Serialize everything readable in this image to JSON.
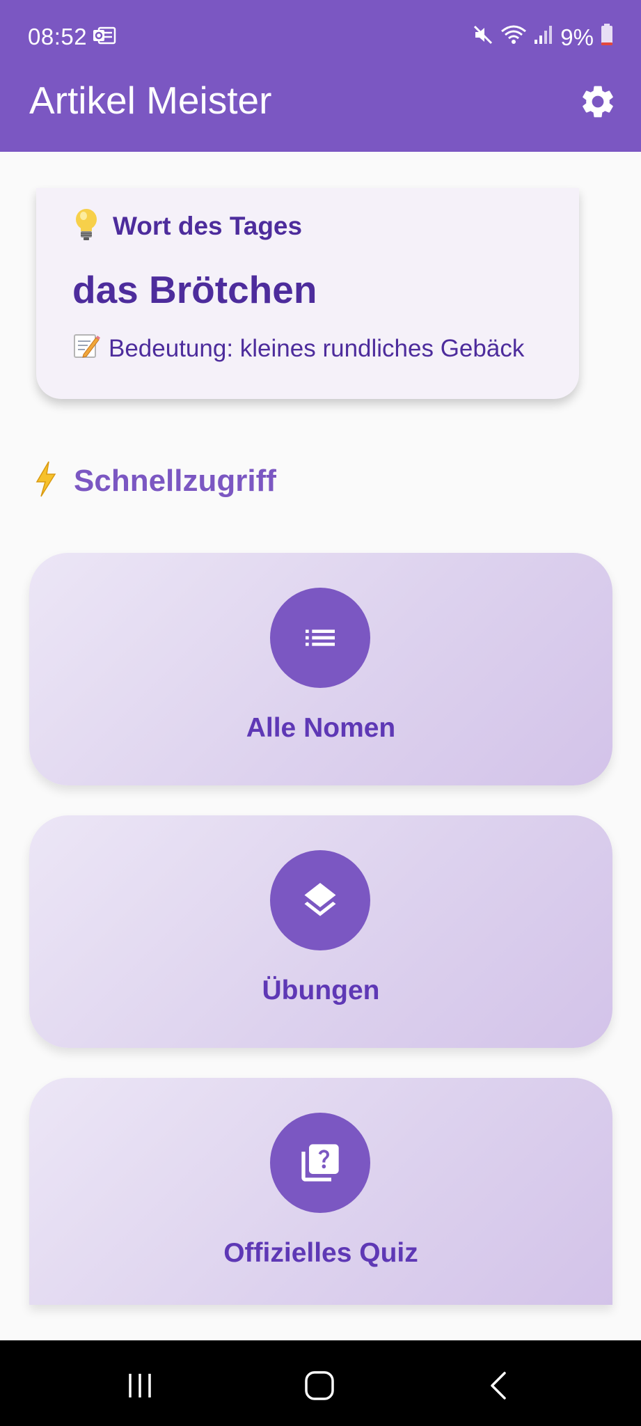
{
  "status_bar": {
    "time": "08:52",
    "battery": "9%"
  },
  "app_bar": {
    "title": "Artikel Meister"
  },
  "word_of_day": {
    "header": "Wort des Tages",
    "word": "das Brötchen",
    "meaning": "Bedeutung: kleines rundliches Gebäck"
  },
  "quick_access": {
    "heading": "Schnellzugriff",
    "tiles": [
      {
        "label": "Alle Nomen",
        "icon": "list-icon"
      },
      {
        "label": "Übungen",
        "icon": "layers-icon"
      },
      {
        "label": "Offizielles Quiz",
        "icon": "quiz-icon"
      }
    ]
  },
  "colors": {
    "primary": "#7b57c2",
    "text_dark": "#4d2c9c",
    "tile_label": "#5e38b5"
  }
}
